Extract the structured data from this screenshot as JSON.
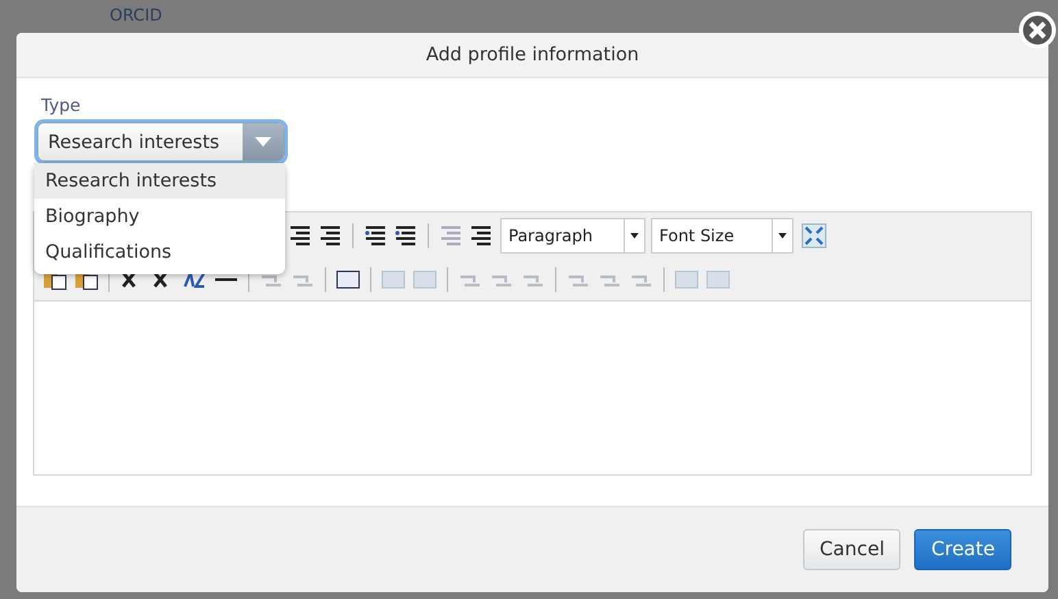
{
  "background": {
    "heading": "ORCID"
  },
  "dialog": {
    "title": "Add profile information",
    "type_field": {
      "label": "Type",
      "value": "Research interests",
      "expanded": true,
      "options": [
        {
          "label": "Research interests",
          "selected": true
        },
        {
          "label": "Biography",
          "selected": false
        },
        {
          "label": "Qualifications",
          "selected": false
        }
      ]
    },
    "editor": {
      "format_select": "Paragraph",
      "font_size_select": "Font Size"
    },
    "buttons": [
      {
        "label": "Cancel",
        "kind": "secondary"
      },
      {
        "label": "Create",
        "kind": "primary"
      }
    ]
  }
}
